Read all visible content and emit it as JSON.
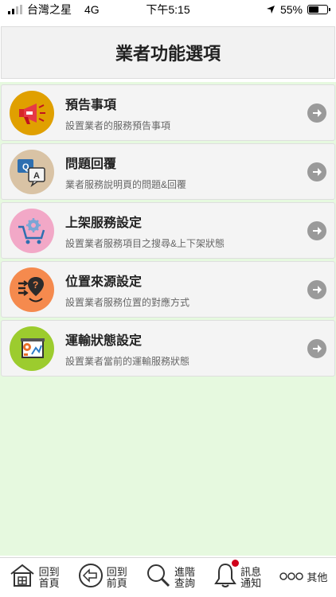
{
  "status_bar": {
    "carrier": "台灣之星",
    "network": "4G",
    "time": "下午5:15",
    "battery": "55%",
    "battery_level": 0.55
  },
  "header": {
    "title": "業者功能選項"
  },
  "menu": {
    "items": [
      {
        "title": "預告事項",
        "subtitle": "設置業者的服務預告事項",
        "icon": "megaphone-icon",
        "color": "#e0a000"
      },
      {
        "title": "問題回覆",
        "subtitle": "業者服務說明頁的問題&回覆",
        "icon": "qa-chat-icon",
        "color": "#d9c3a5"
      },
      {
        "title": "上架服務設定",
        "subtitle": "設置業者服務項目之搜尋&上下架狀態",
        "icon": "cart-gear-icon",
        "color": "#f2a8c7"
      },
      {
        "title": "位置來源設定",
        "subtitle": "設置業者服務位置的對應方式",
        "icon": "location-question-icon",
        "color": "#f58a4e"
      },
      {
        "title": "運輸狀態設定",
        "subtitle": "設置業者當前的運輸服務狀態",
        "icon": "transport-status-icon",
        "color": "#9ccc2e"
      }
    ]
  },
  "bottom_nav": {
    "home": "回到首頁",
    "back": "回到前頁",
    "search": "進階查詢",
    "notify": "訊息通知",
    "more": "其他"
  }
}
